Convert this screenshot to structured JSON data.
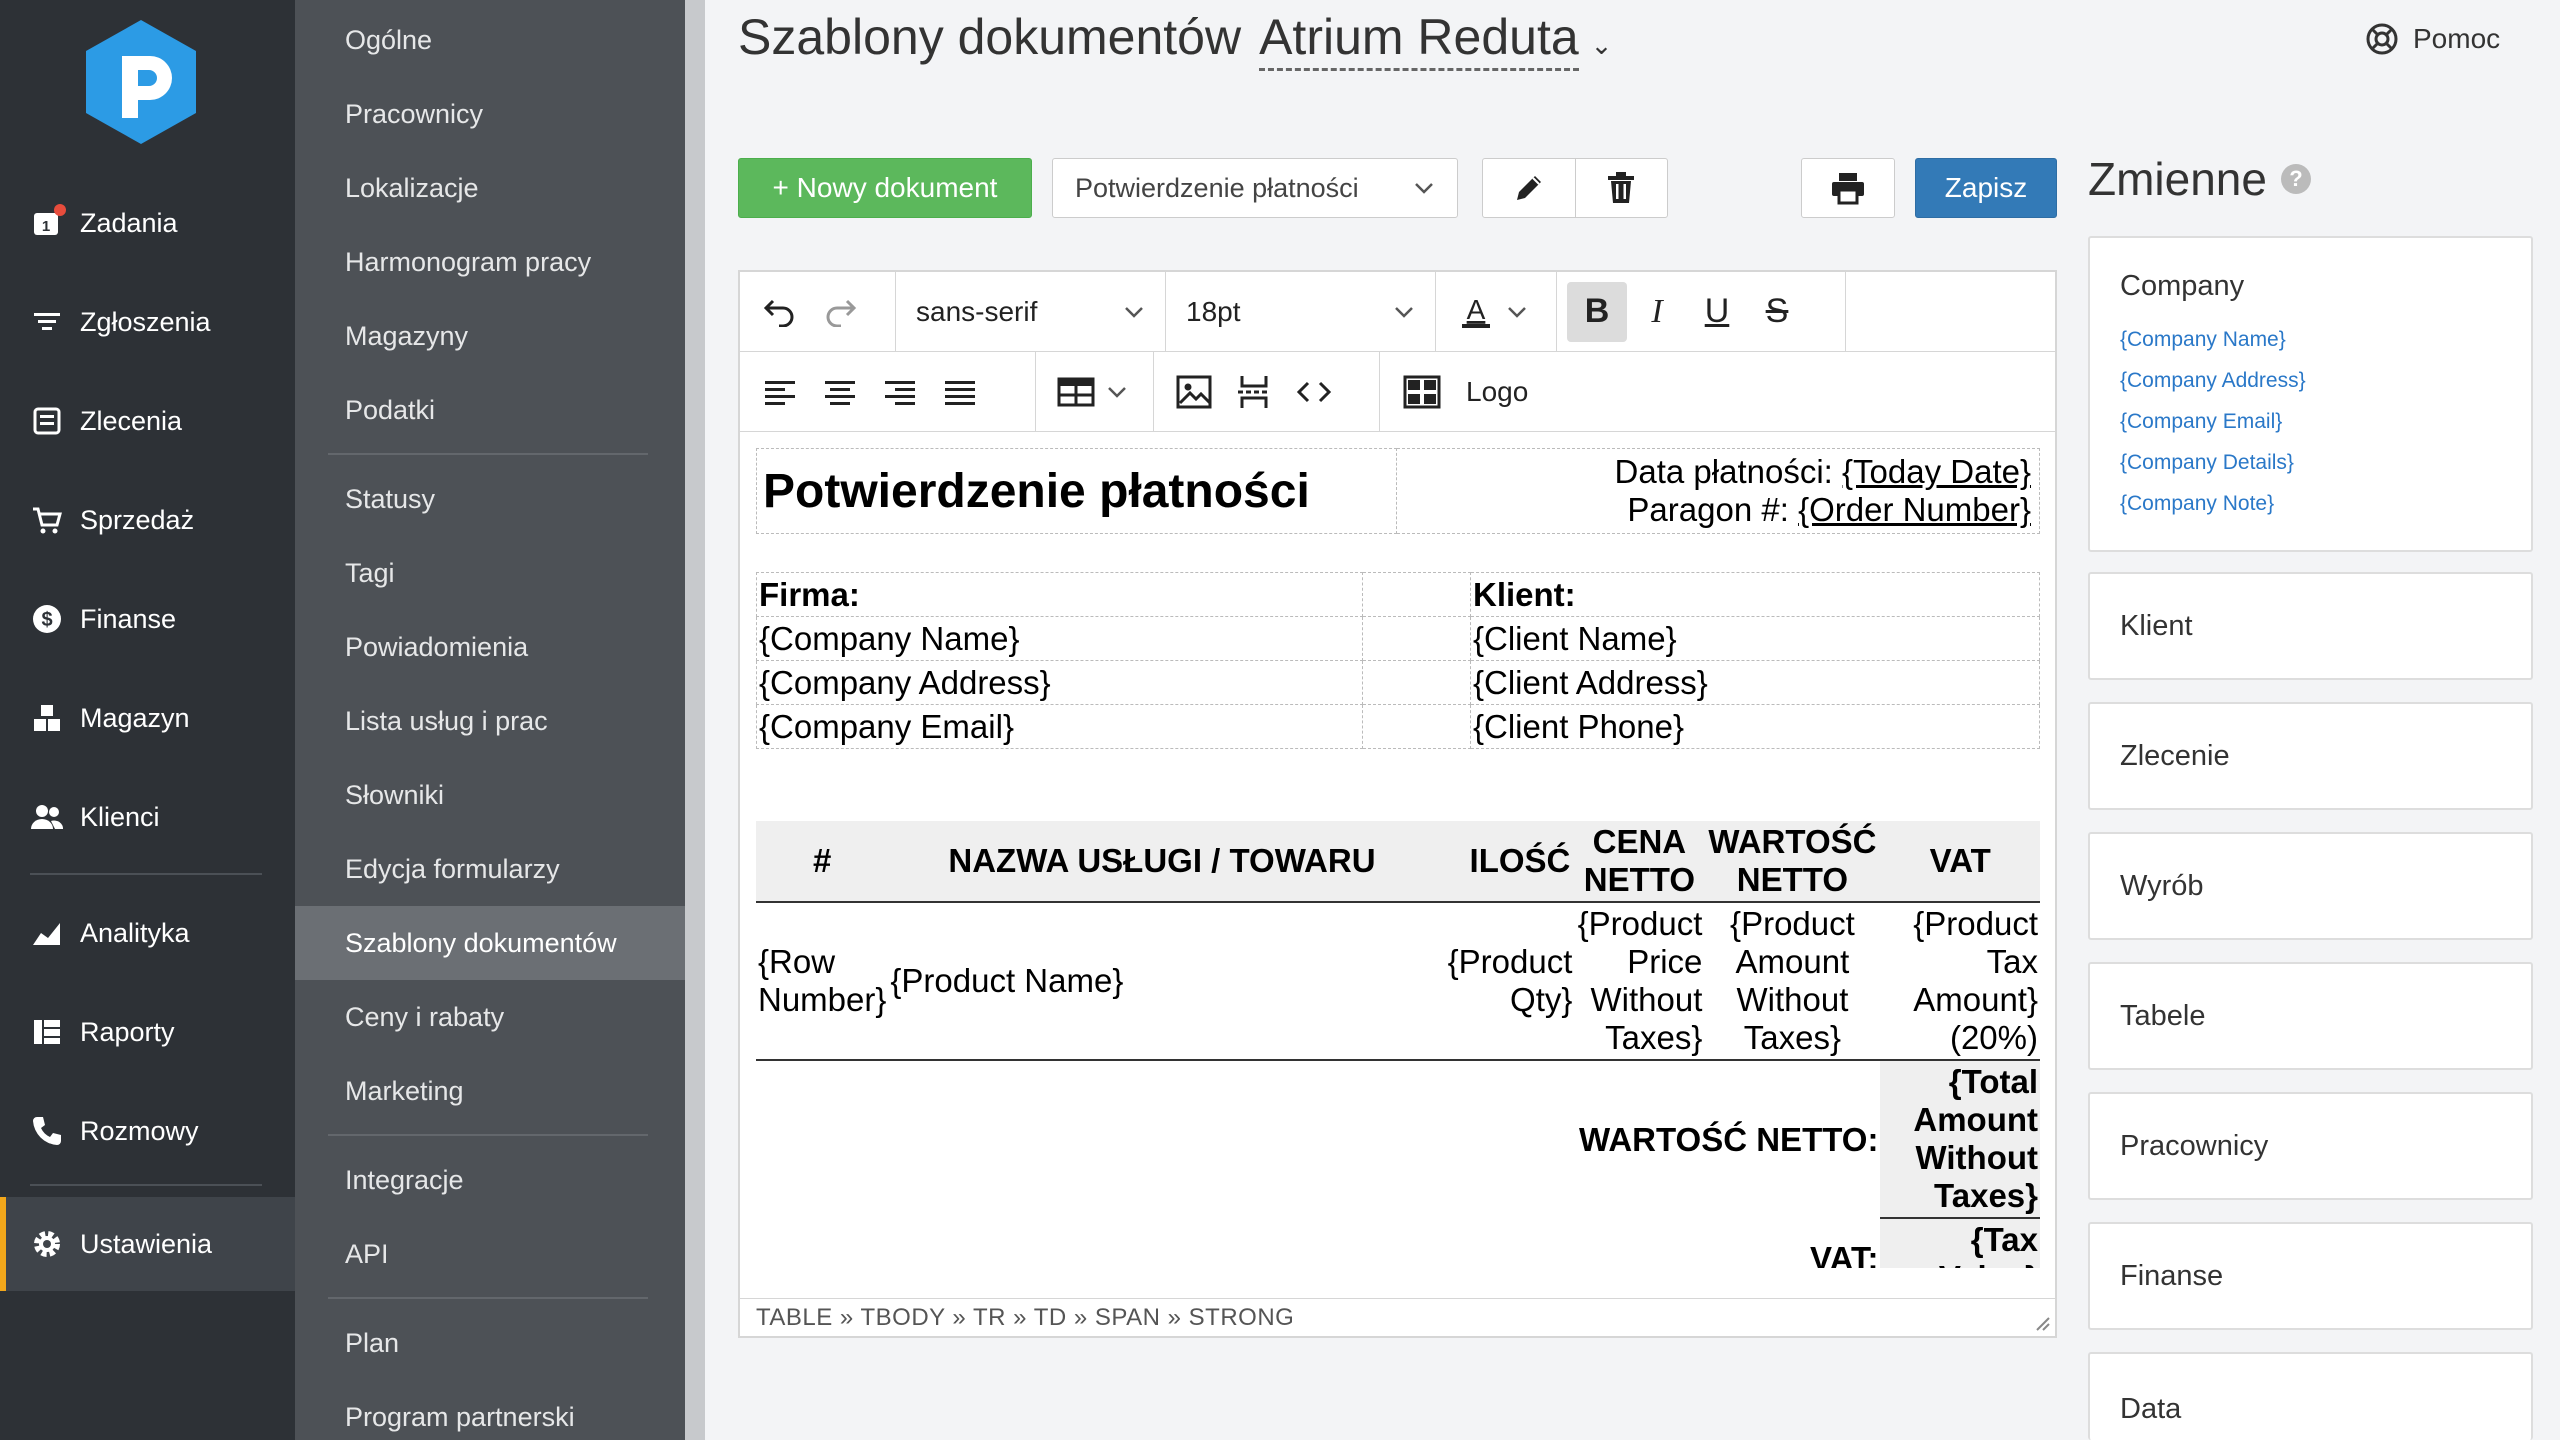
{
  "primary_nav": {
    "items": [
      {
        "label": "Zadania",
        "icon": "tasks-icon"
      },
      {
        "label": "Zgłoszenia",
        "icon": "filter-icon"
      },
      {
        "label": "Zlecenia",
        "icon": "orders-icon"
      },
      {
        "label": "Sprzedaż",
        "icon": "cart-icon"
      },
      {
        "label": "Finanse",
        "icon": "dollar-icon"
      },
      {
        "label": "Magazyn",
        "icon": "boxes-icon"
      },
      {
        "label": "Klienci",
        "icon": "users-icon"
      },
      {
        "label": "Analityka",
        "icon": "chart-icon"
      },
      {
        "label": "Raporty",
        "icon": "reports-icon"
      },
      {
        "label": "Rozmowy",
        "icon": "phone-icon"
      },
      {
        "label": "Ustawienia",
        "icon": "gear-icon"
      }
    ],
    "tasks_badge": "1"
  },
  "settings_nav": {
    "items": [
      "Ogólne",
      "Pracownicy",
      "Lokalizacje",
      "Harmonogram pracy",
      "Magazyny",
      "Podatki",
      "Statusy",
      "Tagi",
      "Powiadomienia",
      "Lista usług i prac",
      "Słowniki",
      "Edycja formularzy",
      "Szablony dokumentów",
      "Ceny i rabaty",
      "Marketing",
      "Integracje",
      "API",
      "Plan",
      "Program partnerski"
    ]
  },
  "header": {
    "title": "Szablony dokumentów",
    "location": "Atrium Reduta",
    "help": "Pomoc"
  },
  "toolbar": {
    "new_document": "+ Nowy dokument",
    "selected_template": "Potwierdzenie płatności",
    "save": "Zapisz"
  },
  "editor": {
    "font_family": "sans-serif",
    "font_size": "18pt",
    "logo_label": "Logo",
    "status_path": "TABLE » TBODY » TR » TD » SPAN » STRONG",
    "doc": {
      "title": "Potwierdzenie płatności",
      "date_label": "Data płatności:",
      "date_value": "{Today Date}",
      "receipt_label": "Paragon #:",
      "receipt_value": "{Order Number}",
      "company_header": "Firma:",
      "client_header": "Klient:",
      "company_lines": [
        "{Company Name}",
        "{Company Address}",
        "{Company Email}"
      ],
      "client_lines": [
        "{Client Name}",
        "{Client Address}",
        "{Client Phone}"
      ],
      "items_headers": {
        "num": "#",
        "name": "NAZWA USŁUGI / TOWARU",
        "qty": "ILOŚĆ",
        "price": "CENA NETTO",
        "amount": "WARTOŚĆ NETTO",
        "vat": "VAT"
      },
      "row": {
        "num": "{Row Number}",
        "name": "{Product Name}",
        "qty": "{Product Qty}",
        "price": "{Product Price Without Taxes}",
        "amount": "{Product Amount Without Taxes}",
        "vat": "{Product Tax Amount} (20%)"
      },
      "net_label": "WARTOŚĆ NETTO:",
      "net_value": "{Total Amount Without Taxes}",
      "vat_label": "VAT:",
      "vat_value": "{Tax Value}"
    }
  },
  "variables": {
    "title": "Zmienne",
    "company": {
      "title": "Company",
      "items": [
        "{Company Name}",
        "{Company Address}",
        "{Company Email}",
        "{Company Details}",
        "{Company Note}"
      ]
    },
    "groups": [
      "Klient",
      "Zlecenie",
      "Wyrób",
      "Tabele",
      "Pracownicy",
      "Finanse",
      "Data"
    ]
  }
}
